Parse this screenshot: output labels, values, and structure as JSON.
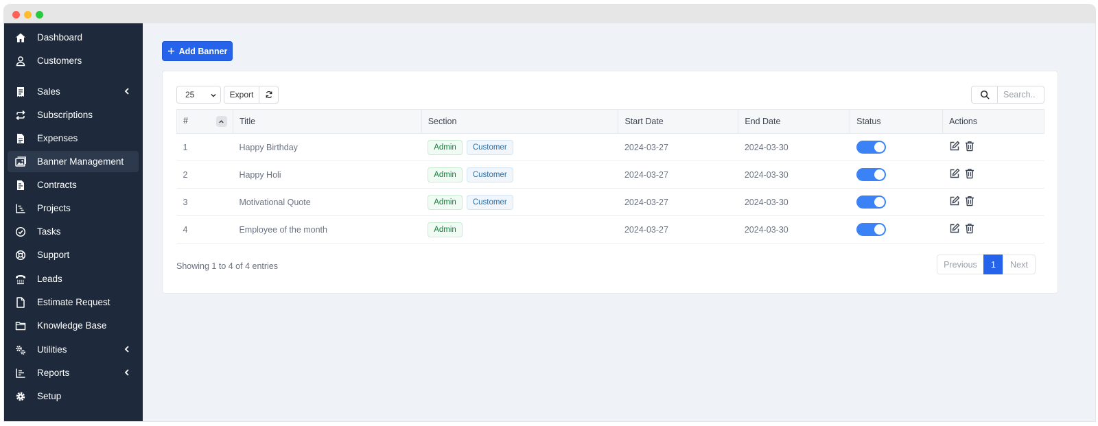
{
  "sidebar": {
    "items": [
      {
        "label": "Dashboard",
        "icon": "home-icon"
      },
      {
        "label": "Customers",
        "icon": "user-icon"
      },
      {
        "label": "Sales",
        "icon": "receipt-icon",
        "chevron": true
      },
      {
        "label": "Subscriptions",
        "icon": "repeat-icon"
      },
      {
        "label": "Expenses",
        "icon": "file-lines-icon"
      },
      {
        "label": "Banner Management",
        "icon": "images-icon",
        "active": true
      },
      {
        "label": "Contracts",
        "icon": "contract-icon"
      },
      {
        "label": "Projects",
        "icon": "chart-gantt-icon"
      },
      {
        "label": "Tasks",
        "icon": "check-circle-icon"
      },
      {
        "label": "Support",
        "icon": "lifebuoy-icon"
      },
      {
        "label": "Leads",
        "icon": "tty-icon"
      },
      {
        "label": "Estimate Request",
        "icon": "file-icon"
      },
      {
        "label": "Knowledge Base",
        "icon": "folder-icon"
      },
      {
        "label": "Utilities",
        "icon": "gears-icon",
        "chevron": true
      },
      {
        "label": "Reports",
        "icon": "chart-bar-icon",
        "chevron": true
      },
      {
        "label": "Setup",
        "icon": "gear-icon"
      }
    ]
  },
  "toolbar": {
    "add_label": "Add Banner",
    "page_size": "25",
    "export_label": "Export",
    "search_placeholder": "Search.."
  },
  "table": {
    "columns": [
      "#",
      "Title",
      "Section",
      "Start Date",
      "End Date",
      "Status",
      "Actions"
    ],
    "rows": [
      {
        "num": "1",
        "title": "Happy Birthday",
        "sections": [
          "Admin",
          "Customer"
        ],
        "start": "2024-03-27",
        "end": "2024-03-30",
        "status": true
      },
      {
        "num": "2",
        "title": "Happy Holi",
        "sections": [
          "Admin",
          "Customer"
        ],
        "start": "2024-03-27",
        "end": "2024-03-30",
        "status": true
      },
      {
        "num": "3",
        "title": "Motivational Quote",
        "sections": [
          "Admin",
          "Customer"
        ],
        "start": "2024-03-27",
        "end": "2024-03-30",
        "status": true
      },
      {
        "num": "4",
        "title": "Employee of the month",
        "sections": [
          "Admin"
        ],
        "start": "2024-03-27",
        "end": "2024-03-30",
        "status": true
      }
    ]
  },
  "footer": {
    "info": "Showing 1 to 4 of 4 entries",
    "previous_label": "Previous",
    "current_page": "1",
    "next_label": "Next"
  },
  "colors": {
    "sidebar_bg": "#1e2a3b",
    "accent": "#2563eb",
    "page_bg": "#eff2f7"
  }
}
